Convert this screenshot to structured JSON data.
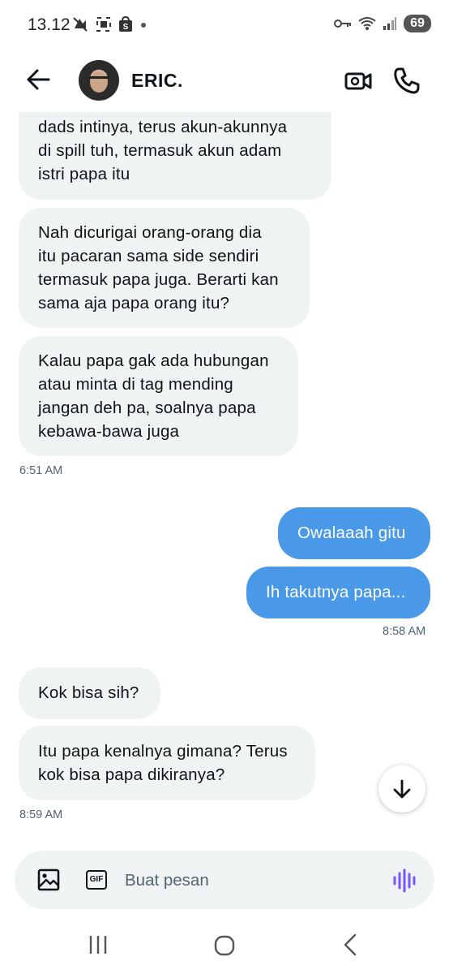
{
  "status_bar": {
    "time": "13.12",
    "battery": "69",
    "icons": [
      "notification-muted-icon",
      "screenshot-icon",
      "shopee-icon",
      "dot-icon",
      "vpn-key-icon",
      "wifi-icon",
      "signal-icon",
      "battery-icon"
    ]
  },
  "header": {
    "contact_name": "ERIC.",
    "back_icon": "arrow-left-icon",
    "video_icon": "video-call-icon",
    "call_icon": "phone-icon"
  },
  "messages": [
    {
      "direction": "in",
      "lines": [
        "dads intinya, terus akun-akunnya",
        "di spill tuh, termasuk akun adam",
        "istri papa itu"
      ]
    },
    {
      "direction": "in",
      "lines": [
        "Nah dicurigai orang-orang dia",
        "itu pacaran sama side sendiri",
        "termasuk papa juga. Berarti kan",
        "sama aja papa orang itu?"
      ]
    },
    {
      "direction": "in",
      "lines": [
        "Kalau papa gak ada hubungan",
        "atau minta di tag mending",
        "jangan deh pa, soalnya papa",
        "kebawa-bawa juga"
      ]
    },
    {
      "direction": "out",
      "lines": [
        "Owalaaah gitu"
      ]
    },
    {
      "direction": "out",
      "lines": [
        "Ih takutnya papa..."
      ]
    },
    {
      "direction": "in",
      "lines": [
        "Kok bisa sih?"
      ]
    },
    {
      "direction": "in",
      "lines": [
        "Itu papa kenalnya gimana? Terus",
        "kok bisa papa dikiranya?"
      ]
    }
  ],
  "timestamps": {
    "t1": "6:51 AM",
    "t2": "8:58 AM",
    "t3": "8:59 AM"
  },
  "scroll_down_icon": "arrow-down-icon",
  "composer": {
    "placeholder": "Buat pesan",
    "gif_label": "GIF",
    "image_icon": "image-icon",
    "voice_icon": "voice-waveform-icon"
  },
  "nav_bar": {
    "recent_icon": "recent-apps-icon",
    "home_icon": "home-icon",
    "back_icon": "back-chevron-icon"
  },
  "colors": {
    "outgoing_bubble": "#4a99e9",
    "incoming_bubble": "#eff3f4",
    "voice_icon": "#7856ff",
    "timestamp": "#536471"
  }
}
